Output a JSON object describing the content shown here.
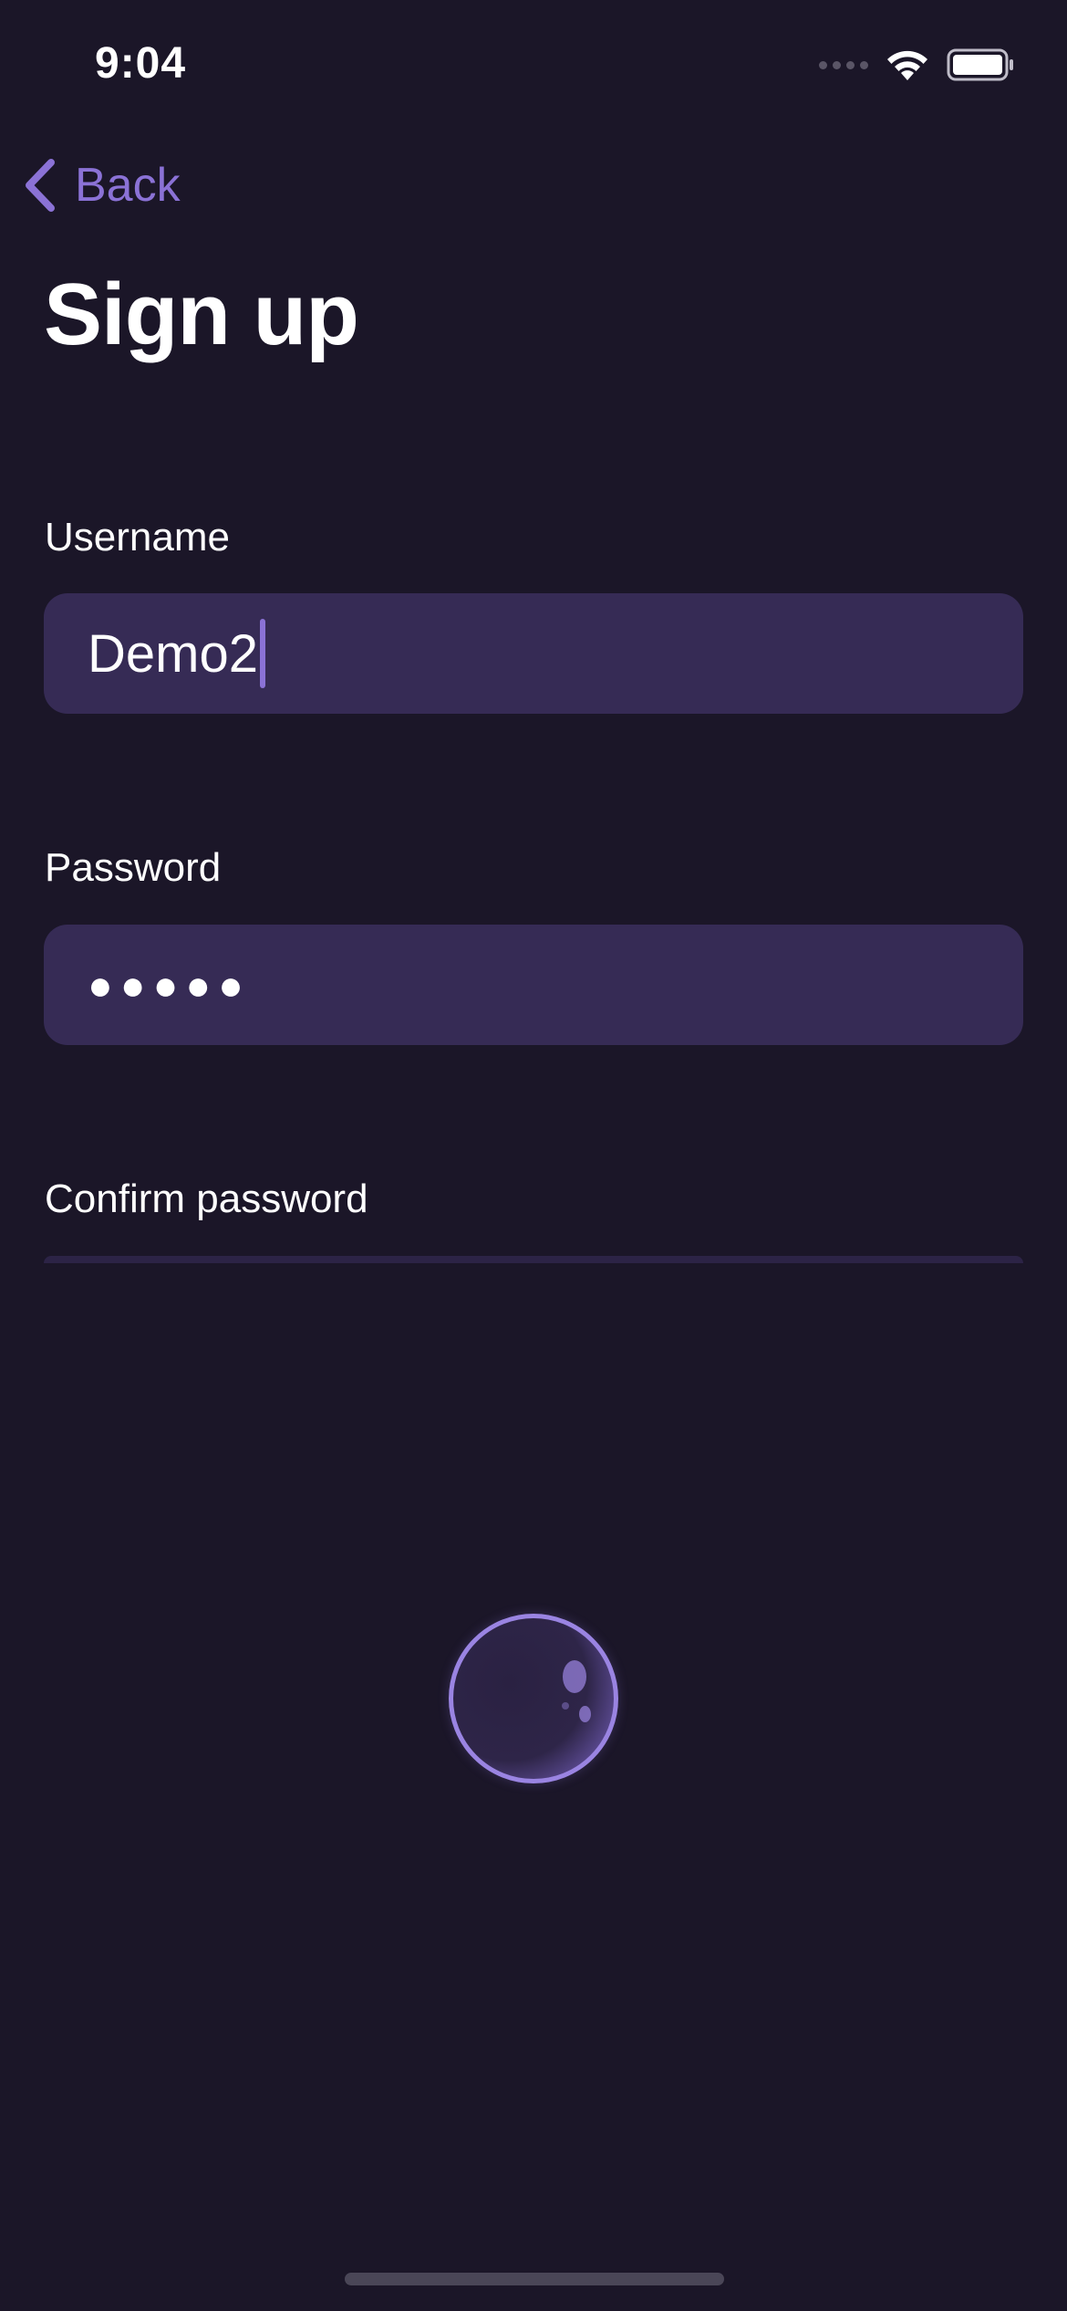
{
  "status_bar": {
    "time": "9:04"
  },
  "nav": {
    "back_label": "Back"
  },
  "page": {
    "title": "Sign up"
  },
  "form": {
    "username": {
      "label": "Username",
      "value": "Demo2"
    },
    "password": {
      "label": "Password",
      "value": "●●●●●"
    },
    "confirm_password": {
      "label": "Confirm password"
    }
  },
  "colors": {
    "background": "#1b1628",
    "field_background": "#362b55",
    "accent": "#8b72d6",
    "text": "#ffffff"
  },
  "icons": {
    "back": "chevron-left-icon",
    "wifi": "wifi-icon",
    "battery": "battery-icon",
    "signal": "cellular-signal-icon",
    "loader": "loading-orb-icon"
  }
}
